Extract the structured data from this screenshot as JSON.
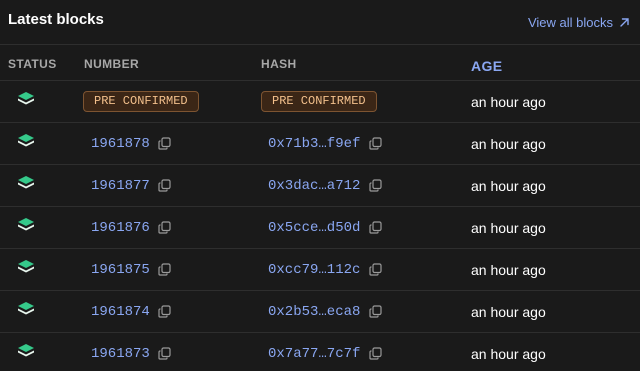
{
  "header": {
    "title": "Latest blocks",
    "view_all_label": "View all blocks",
    "view_all_icon": "arrow-up-right-icon"
  },
  "columns": {
    "status": "STATUS",
    "number": "NUMBER",
    "hash": "HASH",
    "age": "AGE"
  },
  "colors": {
    "accent": "#8aa7f2",
    "badge_text": "#f3c08c",
    "badge_bg": "#3b2616",
    "status_icon": "#35c98a"
  },
  "rows": [
    {
      "status_icon": "layers-icon",
      "number": "PRE CONFIRMED",
      "hash": "PRE CONFIRMED",
      "age": "an hour ago",
      "pending": true
    },
    {
      "status_icon": "layers-icon",
      "number": "1961878",
      "hash": "0x71b3…f9ef",
      "age": "an hour ago",
      "pending": false
    },
    {
      "status_icon": "layers-icon",
      "number": "1961877",
      "hash": "0x3dac…a712",
      "age": "an hour ago",
      "pending": false
    },
    {
      "status_icon": "layers-icon",
      "number": "1961876",
      "hash": "0x5cce…d50d",
      "age": "an hour ago",
      "pending": false
    },
    {
      "status_icon": "layers-icon",
      "number": "1961875",
      "hash": "0xcc79…112c",
      "age": "an hour ago",
      "pending": false
    },
    {
      "status_icon": "layers-icon",
      "number": "1961874",
      "hash": "0x2b53…eca8",
      "age": "an hour ago",
      "pending": false
    },
    {
      "status_icon": "layers-icon",
      "number": "1961873",
      "hash": "0x7a77…7c7f",
      "age": "an hour ago",
      "pending": false
    }
  ]
}
